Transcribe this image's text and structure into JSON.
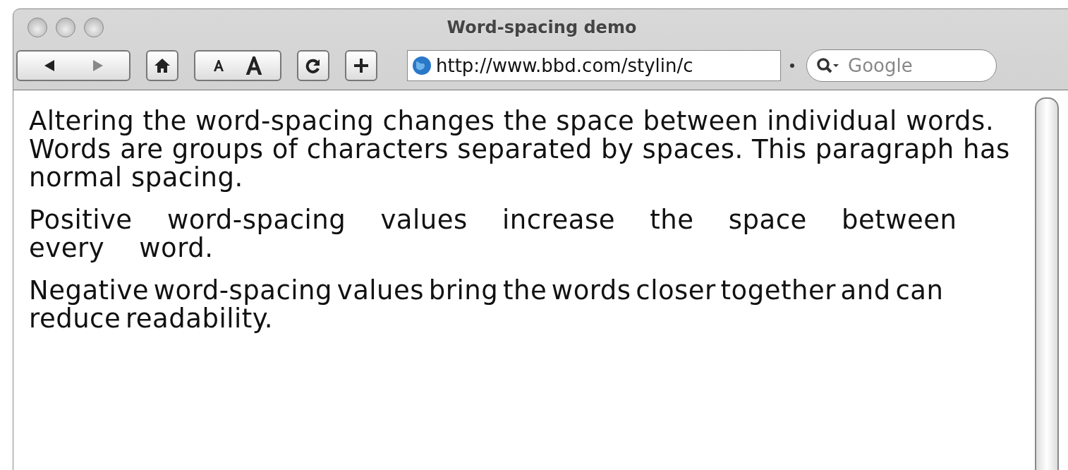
{
  "window": {
    "title": "Word-spacing demo"
  },
  "toolbar": {
    "address": "http://www.bbd.com/stylin/c",
    "search": {
      "placeholder": "Google"
    }
  },
  "paragraphs": [
    {
      "kind": "normal",
      "text": "Altering the word-spacing changes the space between individual words. Words are groups of characters separated by spaces. This paragraph has normal spacing."
    },
    {
      "kind": "positive",
      "text": "Positive word-spacing values increase the space between every word."
    },
    {
      "kind": "negative",
      "text": "Negative word-spacing values bring the words closer together and can reduce readability."
    }
  ]
}
